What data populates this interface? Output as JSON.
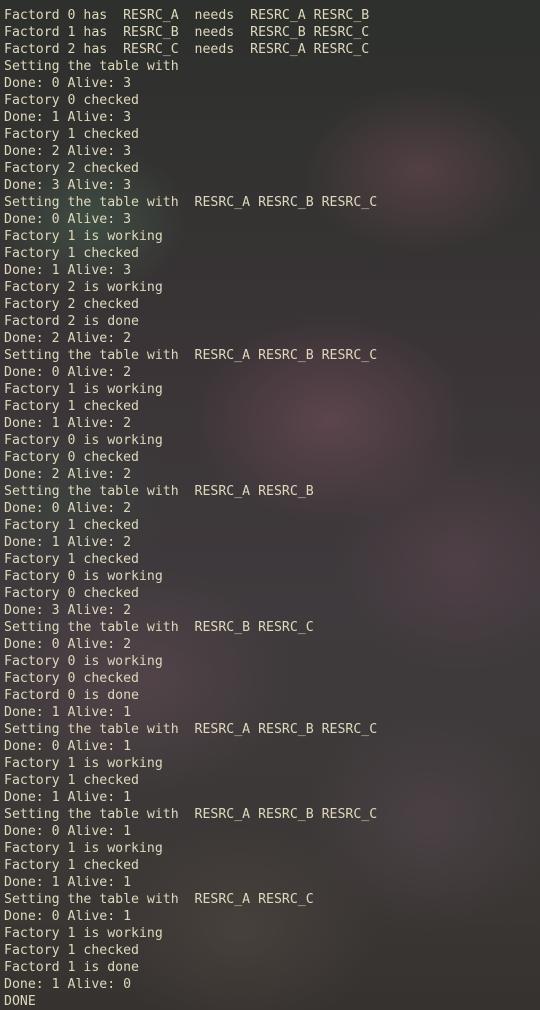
{
  "terminal": {
    "lines": [
      "Factord 0 has  RESRC_A  needs  RESRC_A RESRC_B",
      "Factord 1 has  RESRC_B  needs  RESRC_B RESRC_C",
      "Factord 2 has  RESRC_C  needs  RESRC_A RESRC_C",
      "Setting the table with",
      "Done: 0 Alive: 3",
      "Factory 0 checked",
      "Done: 1 Alive: 3",
      "Factory 1 checked",
      "Done: 2 Alive: 3",
      "Factory 2 checked",
      "Done: 3 Alive: 3",
      "Setting the table with  RESRC_A RESRC_B RESRC_C",
      "Done: 0 Alive: 3",
      "Factory 1 is working",
      "Factory 1 checked",
      "Done: 1 Alive: 3",
      "Factory 2 is working",
      "Factory 2 checked",
      "Factord 2 is done",
      "Done: 2 Alive: 2",
      "Setting the table with  RESRC_A RESRC_B RESRC_C",
      "Done: 0 Alive: 2",
      "Factory 1 is working",
      "Factory 1 checked",
      "Done: 1 Alive: 2",
      "Factory 0 is working",
      "Factory 0 checked",
      "Done: 2 Alive: 2",
      "Setting the table with  RESRC_A RESRC_B",
      "Done: 0 Alive: 2",
      "Factory 1 checked",
      "Done: 1 Alive: 2",
      "Factory 1 checked",
      "Factory 0 is working",
      "Factory 0 checked",
      "Done: 3 Alive: 2",
      "Setting the table with  RESRC_B RESRC_C",
      "Done: 0 Alive: 2",
      "Factory 0 is working",
      "Factory 0 checked",
      "Factord 0 is done",
      "Done: 1 Alive: 1",
      "Setting the table with  RESRC_A RESRC_B RESRC_C",
      "Done: 0 Alive: 1",
      "Factory 1 is working",
      "Factory 1 checked",
      "Done: 1 Alive: 1",
      "Setting the table with  RESRC_A RESRC_B RESRC_C",
      "Done: 0 Alive: 1",
      "Factory 1 is working",
      "Factory 1 checked",
      "Done: 1 Alive: 1",
      "Setting the table with  RESRC_A RESRC_C",
      "Done: 0 Alive: 1",
      "Factory 1 is working",
      "Factory 1 checked",
      "Factord 1 is done",
      "Done: 1 Alive: 0",
      "DONE"
    ]
  }
}
